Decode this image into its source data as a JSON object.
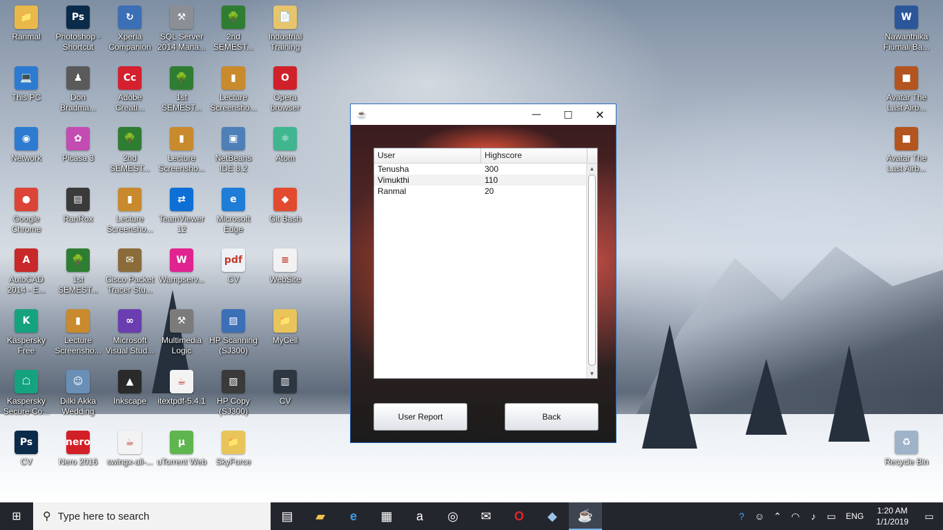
{
  "desktop": {
    "icons": [
      {
        "label": "Ranmal",
        "glyph": "📁",
        "color": "#e8b94a",
        "col": 0,
        "row": 0
      },
      {
        "label": "Photoshop - Shortcut",
        "glyph": "Ps",
        "color": "#0b2b4a",
        "col": 1,
        "row": 0
      },
      {
        "label": "Xperia Companion",
        "glyph": "↻",
        "color": "#3b6fb6",
        "col": 2,
        "row": 0
      },
      {
        "label": "SQL Server 2014 Mana...",
        "glyph": "⚒",
        "color": "#8a8f96",
        "col": 3,
        "row": 0
      },
      {
        "label": "2nd SEMEST...",
        "glyph": "🌳",
        "color": "#2f7d32",
        "col": 4,
        "row": 0
      },
      {
        "label": "Industrial Training",
        "glyph": "📄",
        "color": "#e6c56c",
        "col": 5,
        "row": 0
      },
      {
        "label": "This PC",
        "glyph": "💻",
        "color": "#2d7bd1",
        "col": 0,
        "row": 1
      },
      {
        "label": "Don Bradma...",
        "glyph": "♟",
        "color": "#5a5a5a",
        "col": 1,
        "row": 1
      },
      {
        "label": "Adobe Creati...",
        "glyph": "Cc",
        "color": "#d4202f",
        "col": 2,
        "row": 1
      },
      {
        "label": "1st SEMEST...",
        "glyph": "🌳",
        "color": "#2f7d32",
        "col": 3,
        "row": 1
      },
      {
        "label": "Lecture Screensho...",
        "glyph": "▮",
        "color": "#c98a2d",
        "col": 4,
        "row": 1
      },
      {
        "label": "Opera browser",
        "glyph": "O",
        "color": "#d0202a",
        "col": 5,
        "row": 1
      },
      {
        "label": "Network",
        "glyph": "◉",
        "color": "#2d7bd1",
        "col": 0,
        "row": 2
      },
      {
        "label": "Picasa 3",
        "glyph": "✿",
        "color": "#c34cb2",
        "col": 1,
        "row": 2
      },
      {
        "label": "2nd SEMEST...",
        "glyph": "🌳",
        "color": "#2f7d32",
        "col": 2,
        "row": 2
      },
      {
        "label": "Lecture Screensho...",
        "glyph": "▮",
        "color": "#c98a2d",
        "col": 3,
        "row": 2
      },
      {
        "label": "NetBeans IDE 8.2",
        "glyph": "▣",
        "color": "#4e7fb7",
        "col": 4,
        "row": 2
      },
      {
        "label": "Atom",
        "glyph": "⚛",
        "color": "#3fb68f",
        "col": 5,
        "row": 2
      },
      {
        "label": "Google Chrome",
        "glyph": "●",
        "color": "#dc4437",
        "col": 0,
        "row": 3
      },
      {
        "label": "RanRox",
        "glyph": "▤",
        "color": "#3a3a3a",
        "col": 1,
        "row": 3
      },
      {
        "label": "Lecture Screensho...",
        "glyph": "▮",
        "color": "#c98a2d",
        "col": 2,
        "row": 3
      },
      {
        "label": "TeamViewer 12",
        "glyph": "⇄",
        "color": "#0e6fd6",
        "col": 3,
        "row": 3
      },
      {
        "label": "Microsoft Edge",
        "glyph": "e",
        "color": "#1f7dd7",
        "col": 4,
        "row": 3
      },
      {
        "label": "Git Bash",
        "glyph": "◆",
        "color": "#e24b30",
        "col": 5,
        "row": 3
      },
      {
        "label": "AutoCAD 2014 - E...",
        "glyph": "A",
        "color": "#c8282a",
        "col": 0,
        "row": 4
      },
      {
        "label": "1st SEMEST...",
        "glyph": "🌳",
        "color": "#2f7d32",
        "col": 1,
        "row": 4
      },
      {
        "label": "Cisco Packet Tracer Stu...",
        "glyph": "✉",
        "color": "#8a6b3a",
        "col": 2,
        "row": 4
      },
      {
        "label": "Wampserv...",
        "glyph": "W",
        "color": "#e0238f",
        "col": 3,
        "row": 4
      },
      {
        "label": "CV",
        "glyph": "pdf",
        "color": "#eef2f7",
        "col": 4,
        "row": 4
      },
      {
        "label": "WebSite",
        "glyph": "≡",
        "color": "#f2f2f2",
        "col": 5,
        "row": 4
      },
      {
        "label": "Kaspersky Free",
        "glyph": "K",
        "color": "#15a37f",
        "col": 0,
        "row": 5
      },
      {
        "label": "Lecture Screensho...",
        "glyph": "▮",
        "color": "#c98a2d",
        "col": 1,
        "row": 5
      },
      {
        "label": "Microsoft Visual Stud...",
        "glyph": "∞",
        "color": "#6a3db0",
        "col": 2,
        "row": 5
      },
      {
        "label": "Multimedia Logic",
        "glyph": "⚒",
        "color": "#7b7b7b",
        "col": 3,
        "row": 5
      },
      {
        "label": "HP Scanning (SJ300)",
        "glyph": "▨",
        "color": "#3b6fb6",
        "col": 4,
        "row": 5
      },
      {
        "label": "MyCell",
        "glyph": "📁",
        "color": "#e8c45a",
        "col": 5,
        "row": 5
      },
      {
        "label": "Kaspersky Secure Co...",
        "glyph": "☖",
        "color": "#15a37f",
        "col": 0,
        "row": 6
      },
      {
        "label": "Dilki Akka Wedding",
        "glyph": "☺",
        "color": "#6a8fb6",
        "col": 1,
        "row": 6
      },
      {
        "label": "Inkscape",
        "glyph": "▲",
        "color": "#2a2a2a",
        "col": 2,
        "row": 6
      },
      {
        "label": "itextpdf-5.4.1",
        "glyph": "☕",
        "color": "#f3f3f3",
        "col": 3,
        "row": 6
      },
      {
        "label": "HP Copy (SJ300)",
        "glyph": "▨",
        "color": "#3a3a3a",
        "col": 4,
        "row": 6
      },
      {
        "label": "CV",
        "glyph": "▥",
        "color": "#2d3742",
        "col": 5,
        "row": 6
      },
      {
        "label": "CV",
        "glyph": "Ps",
        "color": "#0b2b4a",
        "col": 0,
        "row": 7
      },
      {
        "label": "Nero 2016",
        "glyph": "nero",
        "color": "#d31f26",
        "col": 1,
        "row": 7
      },
      {
        "label": "swingx-all-...",
        "glyph": "☕",
        "color": "#f3f3f3",
        "col": 2,
        "row": 7
      },
      {
        "label": "uTorrent Web",
        "glyph": "µ",
        "color": "#5fb64f",
        "col": 3,
        "row": 7
      },
      {
        "label": "SkyForce",
        "glyph": "📁",
        "color": "#e8c45a",
        "col": 4,
        "row": 7
      }
    ],
    "right_icons": [
      {
        "label": "Nawanthika Fiumali Ba...",
        "glyph": "W",
        "color": "#2b579a",
        "slot": 0
      },
      {
        "label": "Avatar The Last Airb...",
        "glyph": "■",
        "color": "#b4541f",
        "slot": 1
      },
      {
        "label": "Avatar The Last Airb...",
        "glyph": "■",
        "color": "#b4541f",
        "slot": 2
      },
      {
        "label": "Recycle Bin",
        "glyph": "♻",
        "color": "#9fb3c8",
        "slot": 3
      }
    ]
  },
  "window": {
    "minimize": "—",
    "maximize": "□",
    "close": "✕",
    "table": {
      "columns": [
        "User",
        "Highscore"
      ],
      "rows": [
        {
          "user": "Tenusha",
          "score": "300"
        },
        {
          "user": "Vimukthi",
          "score": "110"
        },
        {
          "user": "Ranmal",
          "score": "20"
        }
      ]
    },
    "buttons": {
      "user_report": "User Report",
      "back": "Back"
    }
  },
  "taskbar": {
    "search_placeholder": "Type here to search",
    "language": "ENG",
    "time": "1:20 AM",
    "date": "1/1/2019"
  }
}
